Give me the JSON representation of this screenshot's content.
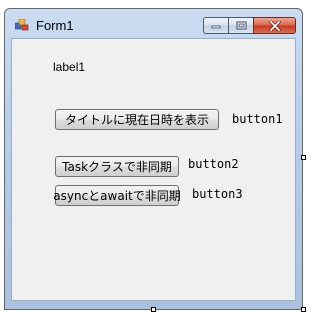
{
  "window": {
    "title": "Form1",
    "icon": "form-icon"
  },
  "caption_buttons": {
    "minimize_icon": "minimize-icon",
    "maximize_icon": "maximize-icon",
    "close_icon": "close-icon"
  },
  "client": {
    "label1_text": "label1",
    "button1_text": "タイトルに現在日時を表示",
    "button1_name": "button1",
    "button2_text": "Taskクラスで非同期",
    "button2_name": "button2",
    "button3_text": "asyncとawaitで非同期",
    "button3_name": "button3"
  },
  "colors": {
    "frame_top": "#c9dcf2",
    "client_bg": "#f0f0f0",
    "close_red": "#c7381f"
  }
}
